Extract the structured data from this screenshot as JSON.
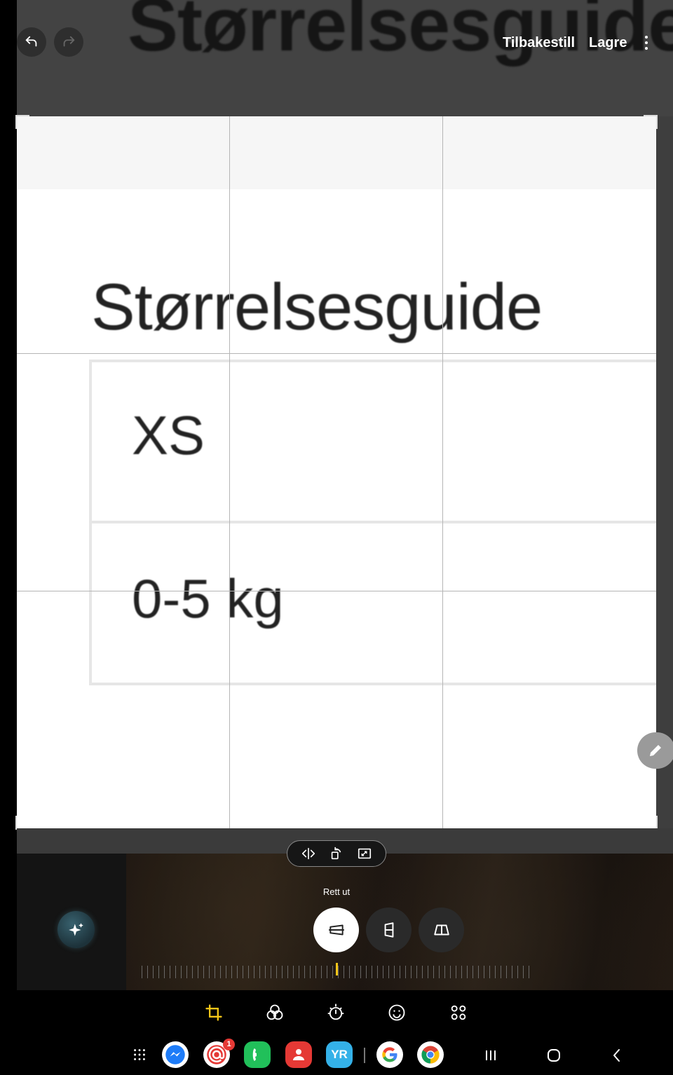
{
  "toolbar": {
    "reset_label": "Tilbakestill",
    "save_label": "Lagre"
  },
  "background_title": "Størrelsesguide",
  "document": {
    "title": "Størrelsesguide",
    "rows": [
      "XS",
      "0-5 kg"
    ]
  },
  "crop_panel": {
    "mode_label": "Rett ut",
    "modes": [
      "straighten",
      "vertical-perspective",
      "horizontal-perspective"
    ],
    "rotation_degrees": 0
  },
  "notification": {
    "mail_badge": "1"
  },
  "dock": {
    "yr_label": "YR"
  },
  "colors": {
    "accent": "#f4c518",
    "canvas_bg": "#ffffff",
    "header_bg": "#434343"
  }
}
